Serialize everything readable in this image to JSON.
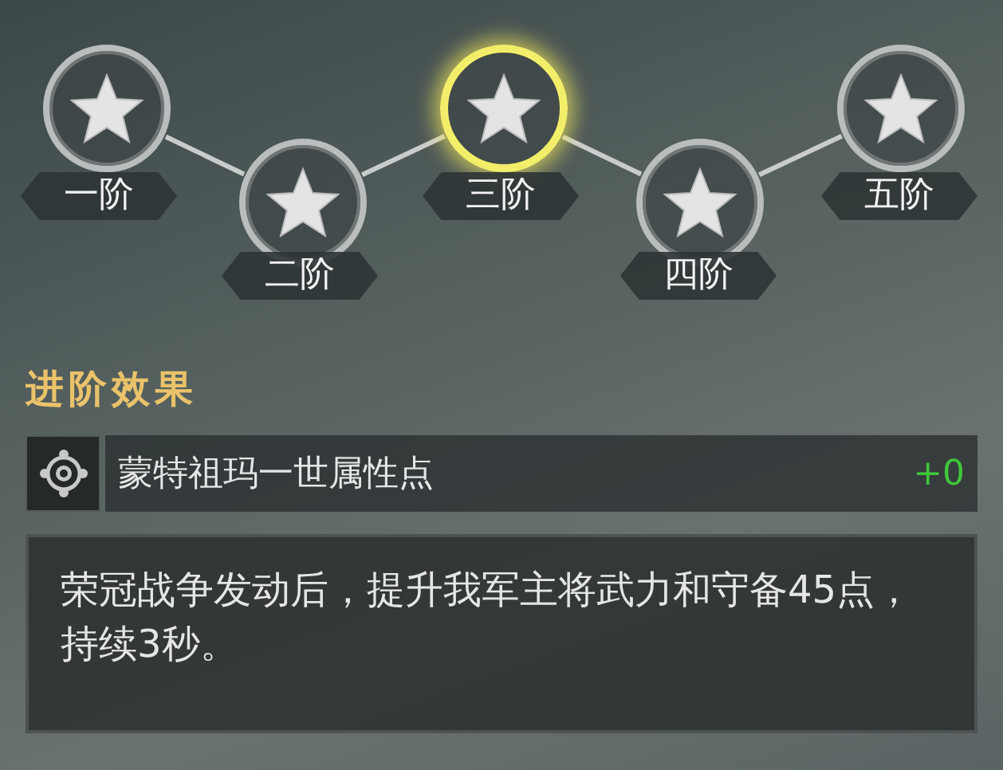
{
  "stages": [
    {
      "label": "一阶",
      "selected": false
    },
    {
      "label": "二阶",
      "selected": false
    },
    {
      "label": "三阶",
      "selected": true
    },
    {
      "label": "四阶",
      "selected": false
    },
    {
      "label": "五阶",
      "selected": false
    }
  ],
  "effects_title": "进阶效果",
  "attribute": {
    "name": "蒙特祖玛一世属性点",
    "value": "+0"
  },
  "description": "荣冠战争发动后，提升我军主将武力和守备45点，持续3秒。"
}
